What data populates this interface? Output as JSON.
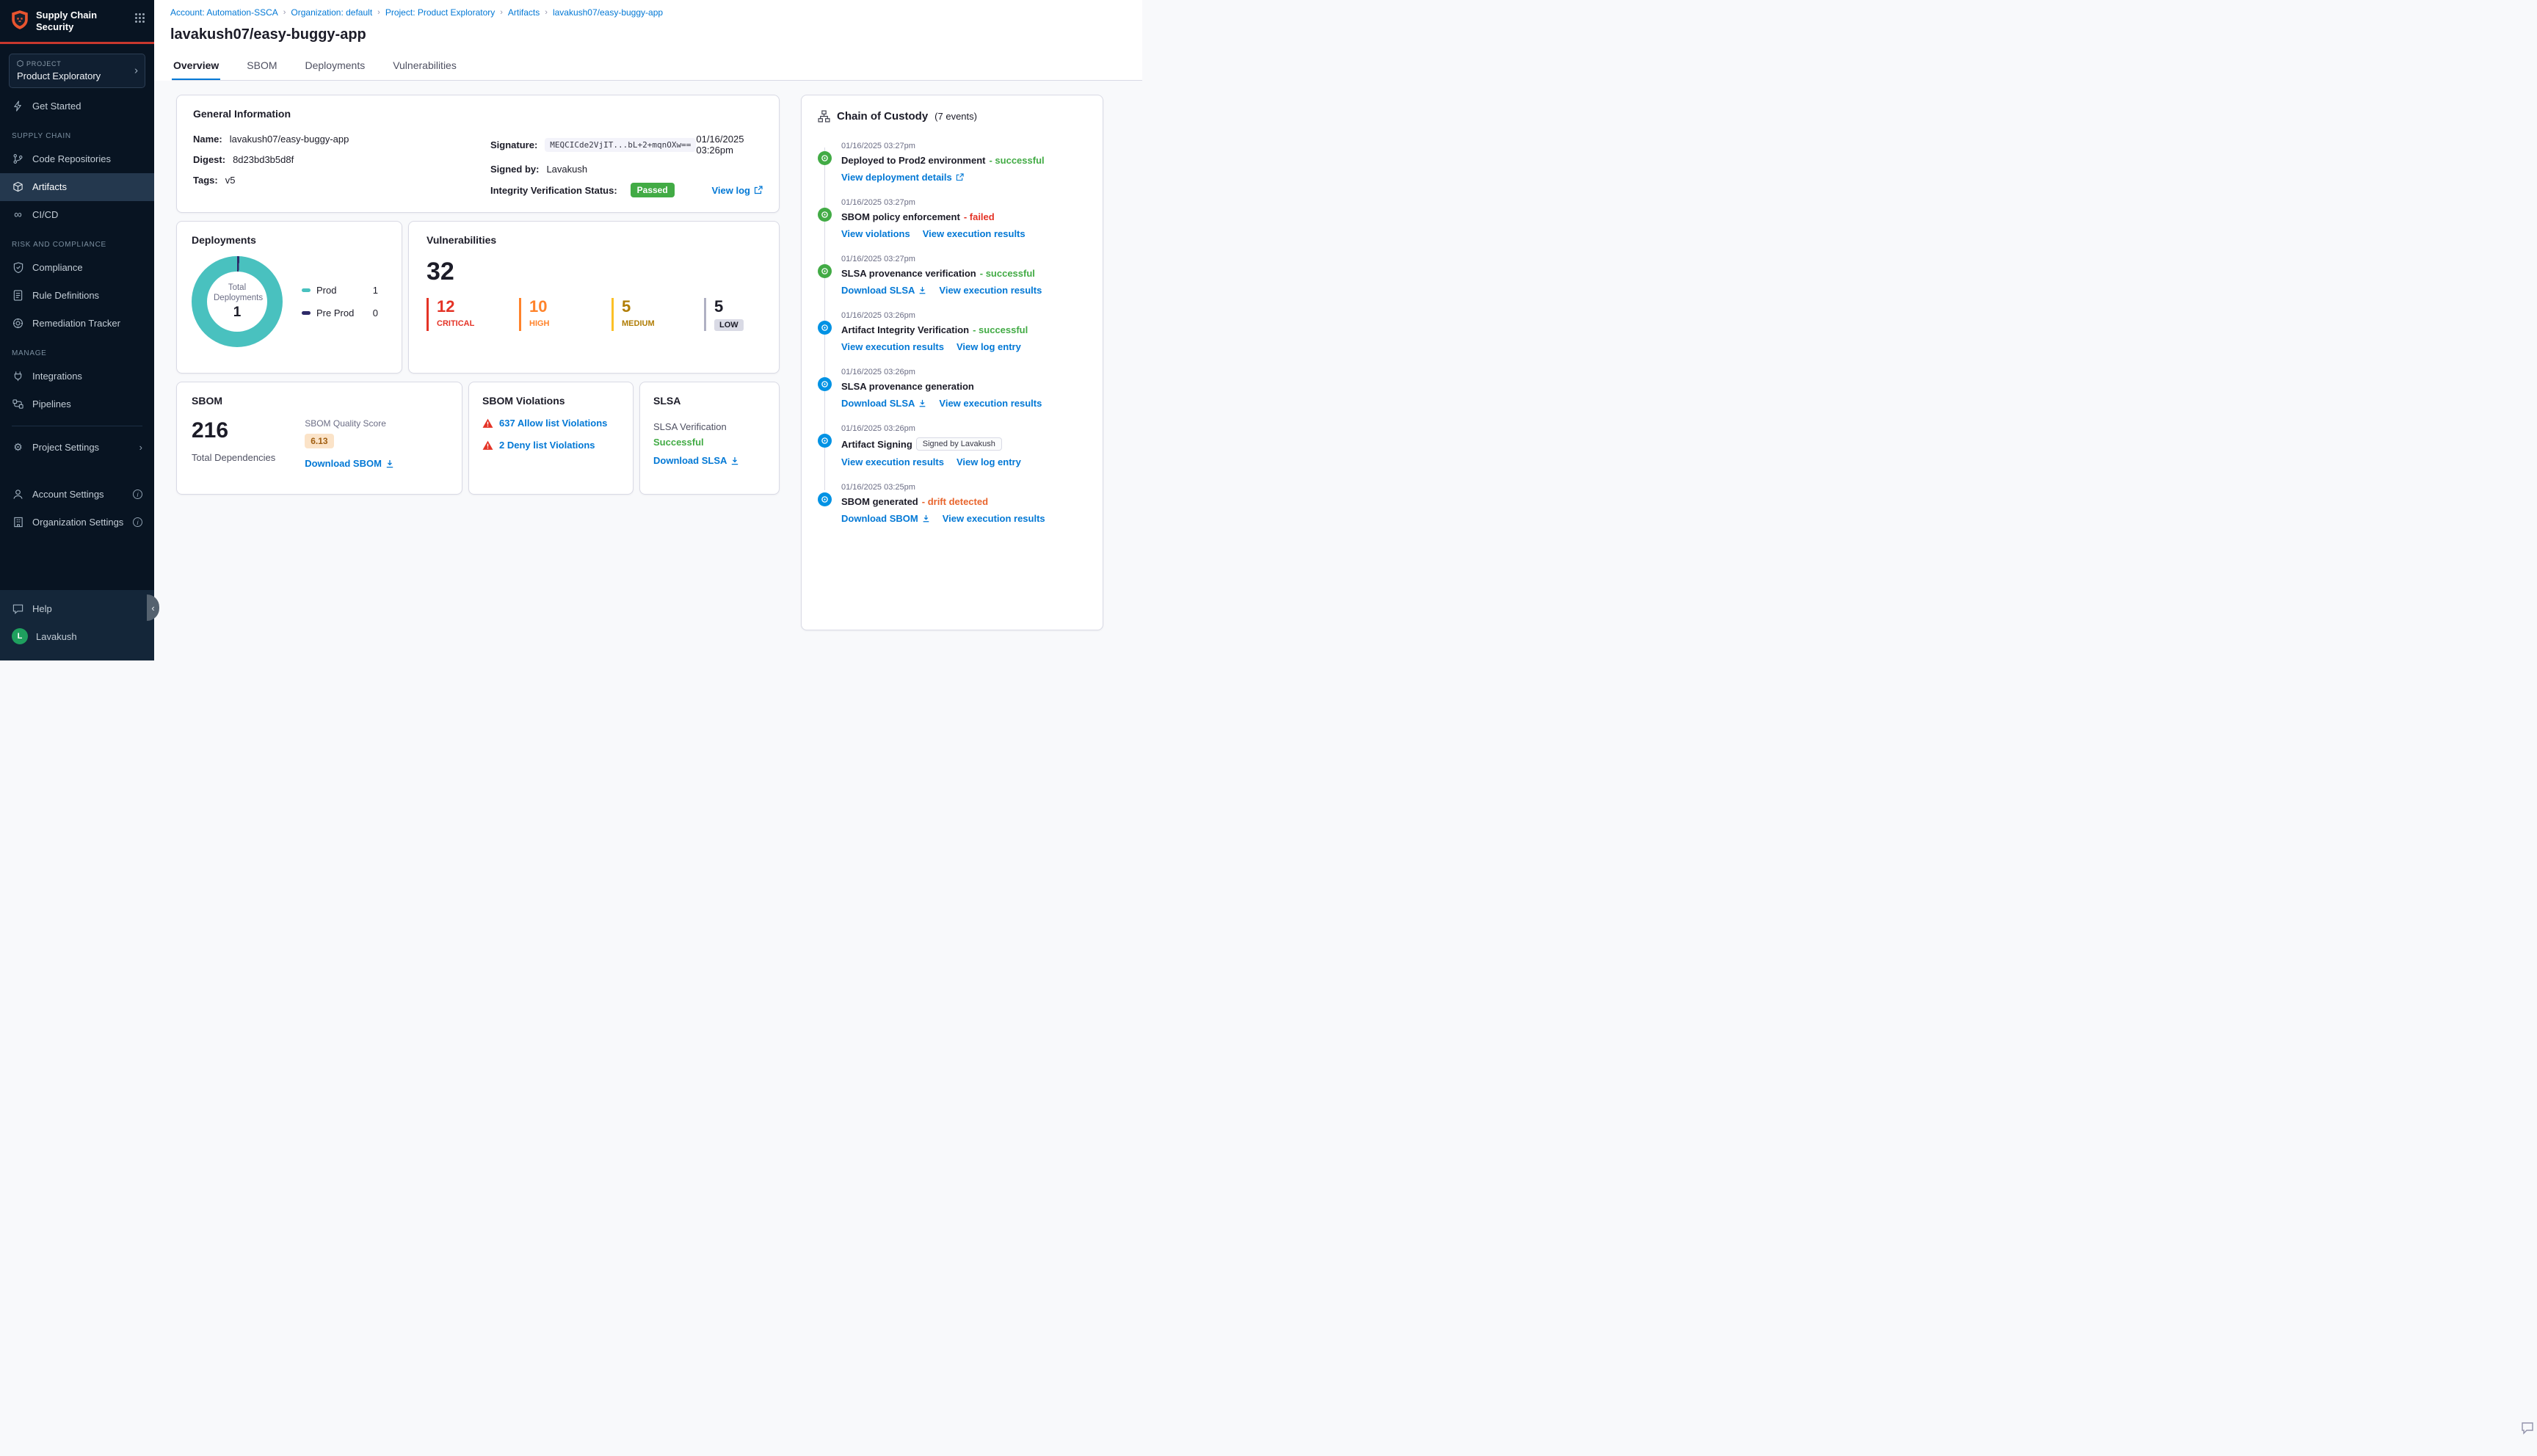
{
  "colors": {
    "brand_red": "#c8382e",
    "accent_blue": "#0278d5",
    "success_green": "#42ab45",
    "failed_red": "#e43326",
    "high_orange": "#ff832b",
    "medium_yellow": "#fcc026",
    "drift_orange": "#e8642c",
    "donut_teal": "#49c1bf",
    "preprod_purple": "#2e2a68",
    "sidebar_bg": "#081422"
  },
  "sidebar": {
    "brand": "Supply Chain Security",
    "project": {
      "label": "PROJECT",
      "name": "Product Exploratory"
    },
    "get_started": "Get Started",
    "sections": {
      "supply_chain": "SUPPLY CHAIN",
      "risk": "RISK AND COMPLIANCE",
      "manage": "MANAGE"
    },
    "items": {
      "code_repositories": "Code Repositories",
      "artifacts": "Artifacts",
      "cicd": "CI/CD",
      "compliance": "Compliance",
      "rule_definitions": "Rule Definitions",
      "remediation_tracker": "Remediation Tracker",
      "integrations": "Integrations",
      "pipelines": "Pipelines",
      "project_settings": "Project Settings",
      "account_settings": "Account Settings",
      "organization_settings": "Organization Settings",
      "help": "Help"
    },
    "user": {
      "initial": "L",
      "name": "Lavakush"
    }
  },
  "breadcrumb": {
    "items": [
      "Account: Automation-SSCA",
      "Organization: default",
      "Project: Product Exploratory",
      "Artifacts",
      "lavakush07/easy-buggy-app"
    ]
  },
  "page_title": "lavakush07/easy-buggy-app",
  "tabs": [
    "Overview",
    "SBOM",
    "Deployments",
    "Vulnerabilities"
  ],
  "general_info": {
    "title": "General Information",
    "name_label": "Name:",
    "name": "lavakush07/easy-buggy-app",
    "digest_label": "Digest:",
    "digest": "8d23bd3b5d8f",
    "tags_label": "Tags:",
    "tags": "v5",
    "signature_label": "Signature:",
    "signature": "MEQCICde2VjIT...bL+2+mqnOXw==",
    "signature_date": "01/16/2025 03:26pm",
    "signed_by_label": "Signed by:",
    "signed_by": "Lavakush",
    "integrity_label": "Integrity Verification Status:",
    "integrity_status": "Passed",
    "view_log": "View log"
  },
  "deployments": {
    "title": "Deployments",
    "center_label": "Total Deployments",
    "total": "1",
    "legend": [
      {
        "label": "Prod",
        "value": "1",
        "color": "#49c1bf"
      },
      {
        "label": "Pre Prod",
        "value": "0",
        "color": "#2e2a68"
      }
    ]
  },
  "vulnerabilities": {
    "title": "Vulnerabilities",
    "total": "32",
    "severities": [
      {
        "count": "12",
        "label": "CRITICAL",
        "color": "#e43326"
      },
      {
        "count": "10",
        "label": "HIGH",
        "color": "#ff832b"
      },
      {
        "count": "5",
        "label": "MEDIUM",
        "color": "#fcc026"
      },
      {
        "count": "5",
        "label": "LOW",
        "color": "#b0b1c3"
      }
    ]
  },
  "sbom": {
    "title": "SBOM",
    "total": "216",
    "total_label": "Total Dependencies",
    "quality_label": "SBOM Quality Score",
    "quality_score": "6.13",
    "download": "Download SBOM"
  },
  "sbom_violations": {
    "title": "SBOM Violations",
    "items": [
      {
        "label": "637 Allow list Violations"
      },
      {
        "label": "2 Deny list Violations"
      }
    ]
  },
  "slsa": {
    "title": "SLSA",
    "verification_label": "SLSA Verification",
    "status": "Successful",
    "download": "Download SLSA"
  },
  "chain_of_custody": {
    "title": "Chain of Custody",
    "count_label": "(7 events)",
    "events": [
      {
        "timestamp": "01/16/2025 03:27pm",
        "title": "Deployed to Prod2 environment",
        "status": "- successful",
        "links": [
          {
            "label": "View deployment details",
            "icon": "external"
          }
        ]
      },
      {
        "timestamp": "01/16/2025 03:27pm",
        "title": "SBOM policy enforcement",
        "status": "- failed",
        "links": [
          {
            "label": "View violations"
          },
          {
            "label": "View execution results"
          }
        ]
      },
      {
        "timestamp": "01/16/2025 03:27pm",
        "title": "SLSA provenance verification",
        "status": "- successful",
        "links": [
          {
            "label": "Download SLSA",
            "icon": "download"
          },
          {
            "label": "View execution results"
          }
        ]
      },
      {
        "timestamp": "01/16/2025 03:26pm",
        "title": "Artifact Integrity Verification",
        "status": "- successful",
        "links": [
          {
            "label": "View execution results"
          },
          {
            "label": "View log entry"
          }
        ]
      },
      {
        "timestamp": "01/16/2025 03:26pm",
        "title": "SLSA provenance generation",
        "status": "",
        "links": [
          {
            "label": "Download SLSA",
            "icon": "download"
          },
          {
            "label": "View execution results"
          }
        ]
      },
      {
        "timestamp": "01/16/2025 03:26pm",
        "title": "Artifact Signing",
        "badge": "Signed by Lavakush",
        "links": [
          {
            "label": "View execution results"
          },
          {
            "label": "View log entry"
          }
        ]
      },
      {
        "timestamp": "01/16/2025 03:25pm",
        "title": "SBOM generated",
        "status": "- drift detected",
        "links": [
          {
            "label": "Download SBOM",
            "icon": "download"
          },
          {
            "label": "View execution results"
          }
        ]
      }
    ]
  }
}
